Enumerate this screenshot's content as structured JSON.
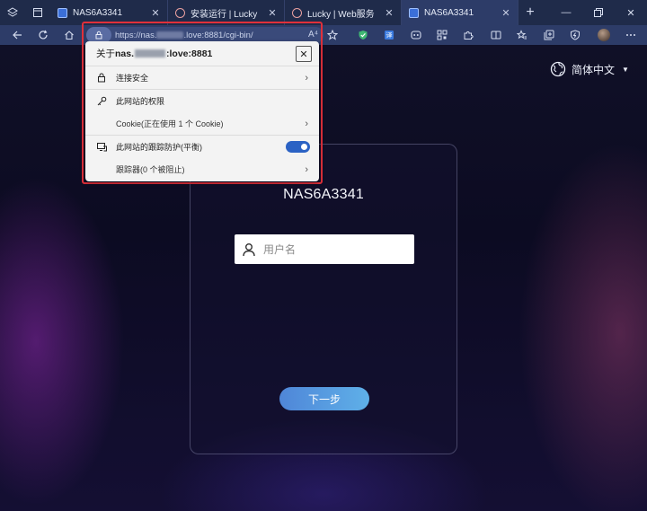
{
  "tabs": [
    {
      "title": "NAS6A3341",
      "favicon": "nas-favicon",
      "active": false
    },
    {
      "title": "安装运行 | Lucky",
      "favicon": "lucky-favicon",
      "active": false
    },
    {
      "title": "Lucky | Web服务",
      "favicon": "lucky-favicon",
      "active": false
    },
    {
      "title": "NAS6A3341",
      "favicon": "nas-favicon",
      "active": true
    }
  ],
  "address": {
    "url_prefix": "https://nas.",
    "url_suffix": ".love:8881/cgi-bin/",
    "read_aloud": "A⁴"
  },
  "site_info": {
    "title_prefix": "关于 ",
    "host_prefix": "nas.",
    "host_suffix": ":love:8881",
    "close_label": "✕",
    "connection_secure": "连接安全",
    "permissions_heading": "此网站的权限",
    "cookies": "Cookie(正在使用 1 个 Cookie)",
    "tracking_prevention": "此网站的跟踪防护(平衡)",
    "tracking_prevention_on": true,
    "trackers": "跟踪器(0 个被阻止)"
  },
  "page": {
    "language": "简体中文",
    "device_name": "NAS6A3341",
    "username_placeholder": "用户名",
    "next_button": "下一步"
  },
  "colors": {
    "chrome_tabbar": "#1f2b4a",
    "chrome_toolbar": "#2d3c68",
    "highlight_outline": "#e0303a",
    "toggle_on": "#2b62c4",
    "next_button": "#4f86d8"
  }
}
